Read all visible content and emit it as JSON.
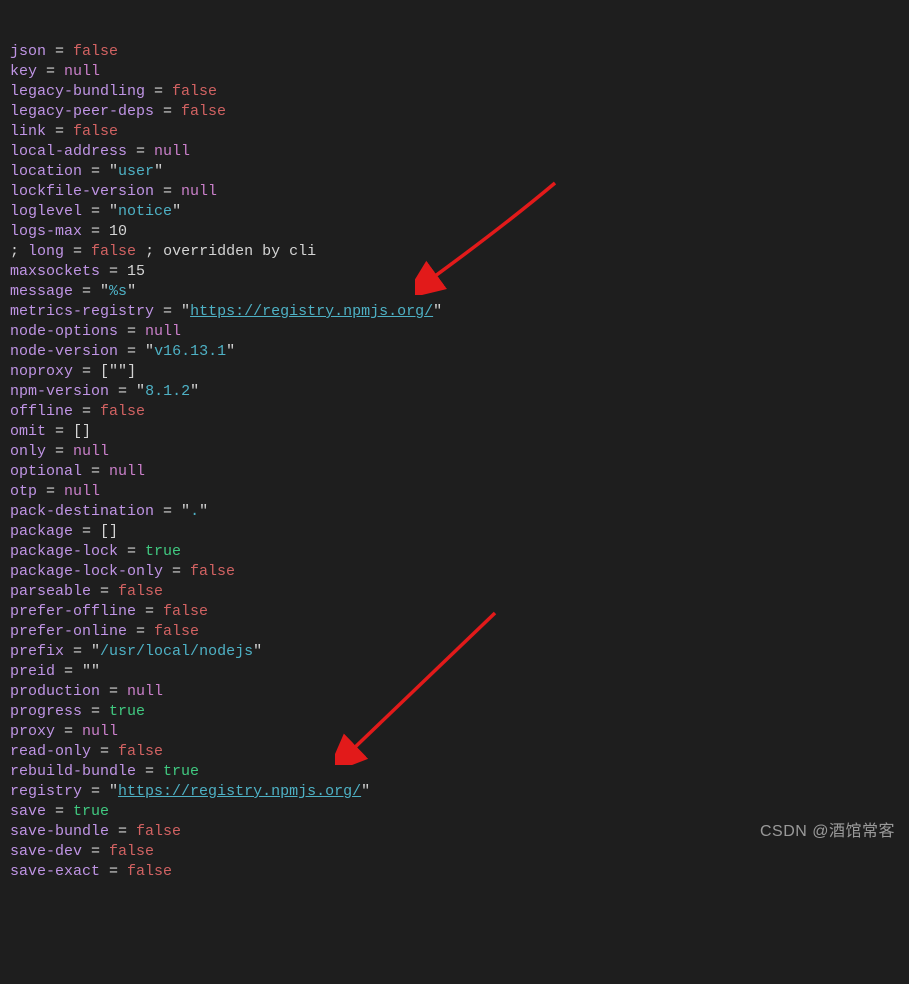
{
  "watermark": "CSDN @酒馆常客",
  "lines": [
    [
      {
        "t": "key",
        "v": "json"
      },
      {
        "t": "punc",
        "v": " = "
      },
      {
        "t": "false",
        "v": "false"
      }
    ],
    [
      {
        "t": "key",
        "v": "key"
      },
      {
        "t": "punc",
        "v": " = "
      },
      {
        "t": "null",
        "v": "null"
      }
    ],
    [
      {
        "t": "key",
        "v": "legacy-bundling"
      },
      {
        "t": "punc",
        "v": " = "
      },
      {
        "t": "false",
        "v": "false"
      }
    ],
    [
      {
        "t": "key",
        "v": "legacy-peer-deps"
      },
      {
        "t": "punc",
        "v": " = "
      },
      {
        "t": "false",
        "v": "false"
      }
    ],
    [
      {
        "t": "key",
        "v": "link"
      },
      {
        "t": "punc",
        "v": " = "
      },
      {
        "t": "false",
        "v": "false"
      }
    ],
    [
      {
        "t": "key",
        "v": "local-address"
      },
      {
        "t": "punc",
        "v": " = "
      },
      {
        "t": "null",
        "v": "null"
      }
    ],
    [
      {
        "t": "key",
        "v": "location"
      },
      {
        "t": "punc",
        "v": " = "
      },
      {
        "t": "punc",
        "v": "\""
      },
      {
        "t": "str",
        "v": "user"
      },
      {
        "t": "punc",
        "v": "\""
      }
    ],
    [
      {
        "t": "key",
        "v": "lockfile-version"
      },
      {
        "t": "punc",
        "v": " = "
      },
      {
        "t": "null",
        "v": "null"
      }
    ],
    [
      {
        "t": "key",
        "v": "loglevel"
      },
      {
        "t": "punc",
        "v": " = "
      },
      {
        "t": "punc",
        "v": "\""
      },
      {
        "t": "str",
        "v": "notice"
      },
      {
        "t": "punc",
        "v": "\""
      }
    ],
    [
      {
        "t": "key",
        "v": "logs-max"
      },
      {
        "t": "punc",
        "v": " = "
      },
      {
        "t": "num",
        "v": "10"
      }
    ],
    [
      {
        "t": "punc",
        "v": "; "
      },
      {
        "t": "key",
        "v": "long"
      },
      {
        "t": "punc",
        "v": " = "
      },
      {
        "t": "false",
        "v": "false"
      },
      {
        "t": "comment",
        "v": " ; overridden by cli"
      }
    ],
    [
      {
        "t": "key",
        "v": "maxsockets"
      },
      {
        "t": "punc",
        "v": " = "
      },
      {
        "t": "num",
        "v": "15"
      }
    ],
    [
      {
        "t": "key",
        "v": "message"
      },
      {
        "t": "punc",
        "v": " = "
      },
      {
        "t": "punc",
        "v": "\""
      },
      {
        "t": "str",
        "v": "%s"
      },
      {
        "t": "punc",
        "v": "\""
      }
    ],
    [
      {
        "t": "key",
        "v": "metrics-registry"
      },
      {
        "t": "punc",
        "v": " = "
      },
      {
        "t": "punc",
        "v": "\""
      },
      {
        "t": "link",
        "v": "https://registry.npmjs.org/"
      },
      {
        "t": "punc",
        "v": "\""
      }
    ],
    [
      {
        "t": "key",
        "v": "node-options"
      },
      {
        "t": "punc",
        "v": " = "
      },
      {
        "t": "null",
        "v": "null"
      }
    ],
    [
      {
        "t": "key",
        "v": "node-version"
      },
      {
        "t": "punc",
        "v": " = "
      },
      {
        "t": "punc",
        "v": "\""
      },
      {
        "t": "str",
        "v": "v16.13.1"
      },
      {
        "t": "punc",
        "v": "\""
      }
    ],
    [
      {
        "t": "key",
        "v": "noproxy"
      },
      {
        "t": "punc",
        "v": " = ["
      },
      {
        "t": "punc",
        "v": "\""
      },
      {
        "t": "punc",
        "v": "\""
      },
      {
        "t": "punc",
        "v": "]"
      }
    ],
    [
      {
        "t": "key",
        "v": "npm-version"
      },
      {
        "t": "punc",
        "v": " = "
      },
      {
        "t": "punc",
        "v": "\""
      },
      {
        "t": "str",
        "v": "8.1.2"
      },
      {
        "t": "punc",
        "v": "\""
      }
    ],
    [
      {
        "t": "key",
        "v": "offline"
      },
      {
        "t": "punc",
        "v": " = "
      },
      {
        "t": "false",
        "v": "false"
      }
    ],
    [
      {
        "t": "key",
        "v": "omit"
      },
      {
        "t": "punc",
        "v": " = []"
      }
    ],
    [
      {
        "t": "key",
        "v": "only"
      },
      {
        "t": "punc",
        "v": " = "
      },
      {
        "t": "null",
        "v": "null"
      }
    ],
    [
      {
        "t": "key",
        "v": "optional"
      },
      {
        "t": "punc",
        "v": " = "
      },
      {
        "t": "null",
        "v": "null"
      }
    ],
    [
      {
        "t": "key",
        "v": "otp"
      },
      {
        "t": "punc",
        "v": " = "
      },
      {
        "t": "null",
        "v": "null"
      }
    ],
    [
      {
        "t": "key",
        "v": "pack-destination"
      },
      {
        "t": "punc",
        "v": " = "
      },
      {
        "t": "punc",
        "v": "\""
      },
      {
        "t": "str",
        "v": "."
      },
      {
        "t": "punc",
        "v": "\""
      }
    ],
    [
      {
        "t": "key",
        "v": "package"
      },
      {
        "t": "punc",
        "v": " = []"
      }
    ],
    [
      {
        "t": "key",
        "v": "package-lock"
      },
      {
        "t": "punc",
        "v": " = "
      },
      {
        "t": "true",
        "v": "true"
      }
    ],
    [
      {
        "t": "key",
        "v": "package-lock-only"
      },
      {
        "t": "punc",
        "v": " = "
      },
      {
        "t": "false",
        "v": "false"
      }
    ],
    [
      {
        "t": "key",
        "v": "parseable"
      },
      {
        "t": "punc",
        "v": " = "
      },
      {
        "t": "false",
        "v": "false"
      }
    ],
    [
      {
        "t": "key",
        "v": "prefer-offline"
      },
      {
        "t": "punc",
        "v": " = "
      },
      {
        "t": "false",
        "v": "false"
      }
    ],
    [
      {
        "t": "key",
        "v": "prefer-online"
      },
      {
        "t": "punc",
        "v": " = "
      },
      {
        "t": "false",
        "v": "false"
      }
    ],
    [
      {
        "t": "key",
        "v": "prefix"
      },
      {
        "t": "punc",
        "v": " = "
      },
      {
        "t": "punc",
        "v": "\""
      },
      {
        "t": "str",
        "v": "/usr/local/nodejs"
      },
      {
        "t": "punc",
        "v": "\""
      }
    ],
    [
      {
        "t": "key",
        "v": "preid"
      },
      {
        "t": "punc",
        "v": " = "
      },
      {
        "t": "punc",
        "v": "\""
      },
      {
        "t": "punc",
        "v": "\""
      }
    ],
    [
      {
        "t": "key",
        "v": "production"
      },
      {
        "t": "punc",
        "v": " = "
      },
      {
        "t": "null",
        "v": "null"
      }
    ],
    [
      {
        "t": "key",
        "v": "progress"
      },
      {
        "t": "punc",
        "v": " = "
      },
      {
        "t": "true",
        "v": "true"
      }
    ],
    [
      {
        "t": "key",
        "v": "proxy"
      },
      {
        "t": "punc",
        "v": " = "
      },
      {
        "t": "null",
        "v": "null"
      }
    ],
    [
      {
        "t": "key",
        "v": "read-only"
      },
      {
        "t": "punc",
        "v": " = "
      },
      {
        "t": "false",
        "v": "false"
      }
    ],
    [
      {
        "t": "key",
        "v": "rebuild-bundle"
      },
      {
        "t": "punc",
        "v": " = "
      },
      {
        "t": "true",
        "v": "true"
      }
    ],
    [
      {
        "t": "key",
        "v": "registry"
      },
      {
        "t": "punc",
        "v": " = "
      },
      {
        "t": "punc",
        "v": "\""
      },
      {
        "t": "link",
        "v": "https://registry.npmjs.org/"
      },
      {
        "t": "punc",
        "v": "\""
      }
    ],
    [
      {
        "t": "key",
        "v": "save"
      },
      {
        "t": "punc",
        "v": " = "
      },
      {
        "t": "true",
        "v": "true"
      }
    ],
    [
      {
        "t": "key",
        "v": "save-bundle"
      },
      {
        "t": "punc",
        "v": " = "
      },
      {
        "t": "false",
        "v": "false"
      }
    ],
    [
      {
        "t": "key",
        "v": "save-dev"
      },
      {
        "t": "punc",
        "v": " = "
      },
      {
        "t": "false",
        "v": "false"
      }
    ],
    [
      {
        "t": "key",
        "v": "save-exact"
      },
      {
        "t": "punc",
        "v": " = "
      },
      {
        "t": "false",
        "v": "false"
      }
    ]
  ]
}
